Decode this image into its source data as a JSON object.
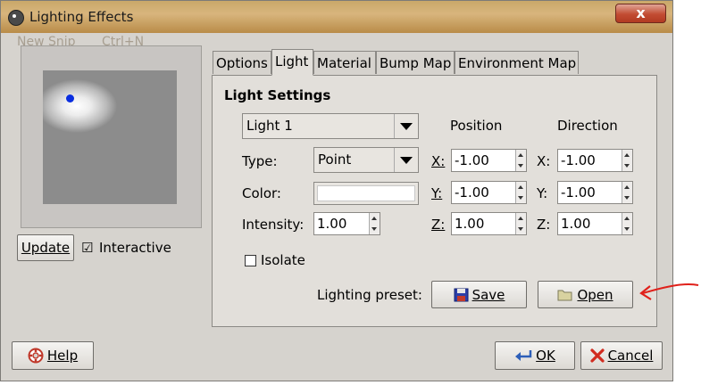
{
  "window": {
    "title": "Lighting Effects",
    "close": "x",
    "bg_text_1": "New Snip",
    "bg_text_2": "Ctrl+N"
  },
  "preview": {
    "update_button": "Update",
    "interactive_label": "Interactive",
    "interactive_checked": "☑"
  },
  "tabs": [
    "Options",
    "Light",
    "Material",
    "Bump Map",
    "Environment Map"
  ],
  "light_settings": {
    "heading": "Light Settings",
    "light_select": "Light 1",
    "position_header": "Position",
    "direction_header": "Direction",
    "type_label": "Type:",
    "type_value": "Point",
    "color_label": "Color:",
    "color_value": "#ffffff",
    "intensity_label": "Intensity:",
    "intensity_value": "1.00",
    "isolate_label": "Isolate",
    "position": {
      "x_label": "X:",
      "x": "-1.00",
      "y_label": "Y:",
      "y": "-1.00",
      "z_label": "Z:",
      "z": "1.00"
    },
    "direction": {
      "x_label": "X:",
      "x": "-1.00",
      "y_label": "Y:",
      "y": "-1.00",
      "z_label": "Z:",
      "z": "1.00"
    },
    "preset_label": "Lighting preset:",
    "save_button": "Save",
    "open_button": "Open"
  },
  "footer": {
    "help_button": "Help",
    "ok_button": "OK",
    "cancel_button": "Cancel"
  },
  "colors": {
    "dialog_bg": "#d6d3ce",
    "annotation_arrow": "#e0201a",
    "light_dot": "#0a2ee0"
  }
}
